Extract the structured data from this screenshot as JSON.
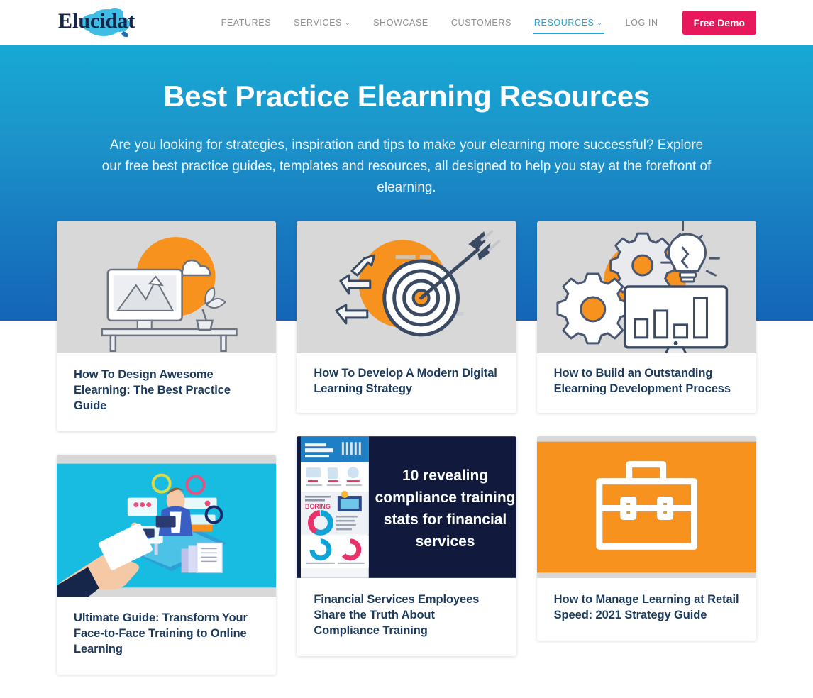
{
  "header": {
    "logo_text": "Elucidat",
    "logo_icon": "cloud-logo",
    "nav": [
      {
        "label": "FEATURES",
        "has_caret": false,
        "active": false
      },
      {
        "label": "SERVICES",
        "has_caret": true,
        "active": false
      },
      {
        "label": "SHOWCASE",
        "has_caret": false,
        "active": false
      },
      {
        "label": "CUSTOMERS",
        "has_caret": false,
        "active": false
      },
      {
        "label": "RESOURCES",
        "has_caret": true,
        "active": true
      },
      {
        "label": "LOG IN",
        "has_caret": false,
        "active": false
      }
    ],
    "demo_button": "Free Demo",
    "caret_glyph": "⌄"
  },
  "hero": {
    "title": "Best Practice Elearning Resources",
    "subtitle": "Are you looking for strategies, inspiration and tips to make your elearning more successful? Explore our free best practice guides, templates and resources, all designed to help you stay at the forefront of elearning."
  },
  "cards": [
    {
      "title": "How To Design Awesome Elearning: The Best Practice Guide",
      "thumb_kind": "desk-monitor-illustration",
      "thumb_bg": "#d8d8d8",
      "accent": "#F7921E"
    },
    {
      "title": "How To Develop A Modern Digital Learning Strategy",
      "thumb_kind": "target-arrow-illustration",
      "thumb_bg": "#d8d8d8",
      "accent": "#F7921E"
    },
    {
      "title": "How to Build an Outstanding Elearning Development Process",
      "thumb_kind": "gears-lightbulb-chart-illustration",
      "thumb_bg": "#d8d8d8",
      "accent": "#F7921E"
    },
    {
      "title": "Ultimate Guide: Transform Your Face-to-Face Training to Online Learning",
      "thumb_kind": "hand-phone-isometric-illustration",
      "thumb_bg": "#17BCE0",
      "accent": "#ffffff"
    },
    {
      "title": "Financial Services Employees Share the Truth About Compliance Training",
      "thumb_kind": "compliance-stats-infographic",
      "thumb_bg": "#111a3c",
      "thumb_overlay_text": "10 revealing compliance training stats for financial services",
      "accent": "#ffffff"
    },
    {
      "title": "How to Manage Learning at Retail Speed: 2021 Strategy Guide",
      "thumb_kind": "briefcase-icon-card",
      "thumb_bg": "#F7921E",
      "accent": "#ffffff"
    }
  ],
  "colors": {
    "brand_cyan": "#17A9D4",
    "brand_blue": "#1565B8",
    "accent_pink": "#E8185D",
    "accent_orange": "#F7921E",
    "navy_text": "#1b3a5c",
    "dark_navy": "#111a3c"
  }
}
